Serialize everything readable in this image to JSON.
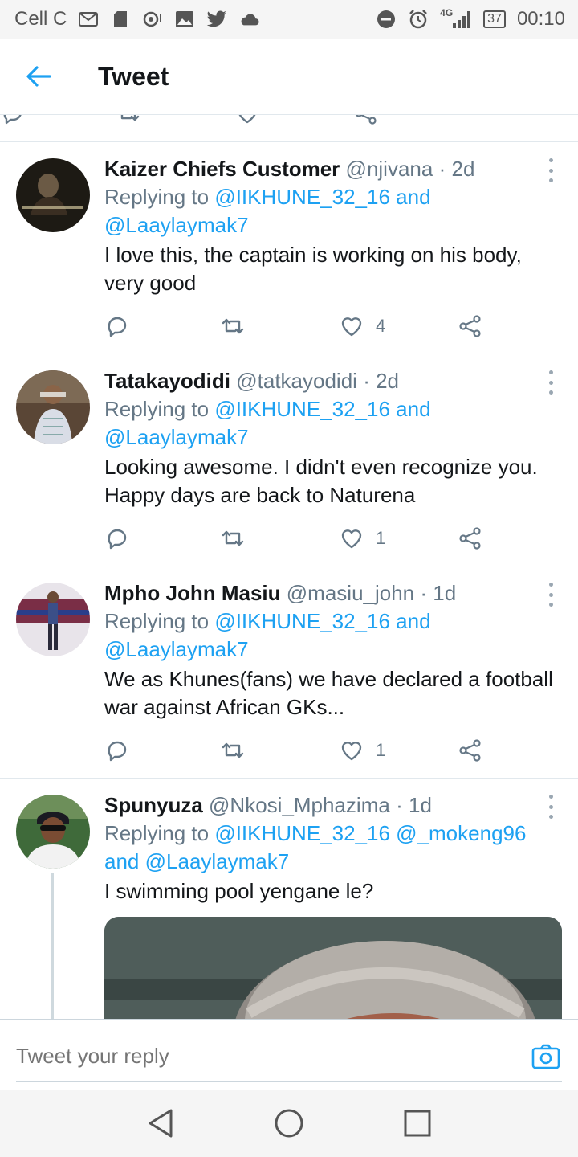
{
  "status_bar": {
    "carrier": "Cell C",
    "network": "4G",
    "battery": "37",
    "time": "00:10",
    "icons_left": [
      "gmail-icon",
      "sdcard-icon",
      "location-icon",
      "gallery-icon",
      "twitter-icon",
      "cloud-icon"
    ],
    "icons_right": [
      "dnd-icon",
      "alarm-icon",
      "signal-icon",
      "battery-icon"
    ]
  },
  "app_bar": {
    "title": "Tweet"
  },
  "tweets": [
    {
      "name": "Kaizer Chiefs Customer",
      "handle": "@njivana",
      "time": "2d",
      "replying_prefix": "Replying to",
      "mention1": "@IIKHUNE_32_16",
      "joiner": "and",
      "mention2": "@Laaylaymak7",
      "text": "I love this, the captain is working on his body, very good",
      "likes": "4"
    },
    {
      "name": "Tatakayodidi",
      "handle": "@tatkayodidi",
      "time": "2d",
      "replying_prefix": "Replying to",
      "mention1": "@IIKHUNE_32_16",
      "joiner": "and",
      "mention2": "@Laaylaymak7",
      "text": "Looking awesome. I didn't even recognize you. Happy days are back to Naturena",
      "likes": "1"
    },
    {
      "name": "Mpho John Masiu",
      "handle": "@masiu_john",
      "time": "1d",
      "replying_prefix": "Replying to",
      "mention1": "@IIKHUNE_32_16",
      "joiner": "and",
      "mention2": "@Laaylaymak7",
      "text": "We as Khunes(fans) we have declared a football war against African GKs...",
      "likes": "1"
    },
    {
      "name": "Spunyuza",
      "handle": "@Nkosi_Mphazima",
      "time": "1d",
      "replying_prefix": "Replying to",
      "mention1": "@IIKHUNE_32_16",
      "mention_extra": "@_mokeng96",
      "joiner": "and",
      "mention2": "@Laaylaymak7",
      "text": "I swimming pool yengane le?"
    }
  ],
  "reply_bar": {
    "placeholder": "Tweet your reply"
  },
  "colors": {
    "accent": "#1da1f2",
    "muted": "#657786",
    "text": "#14171a",
    "divider": "#e1e8ed"
  }
}
